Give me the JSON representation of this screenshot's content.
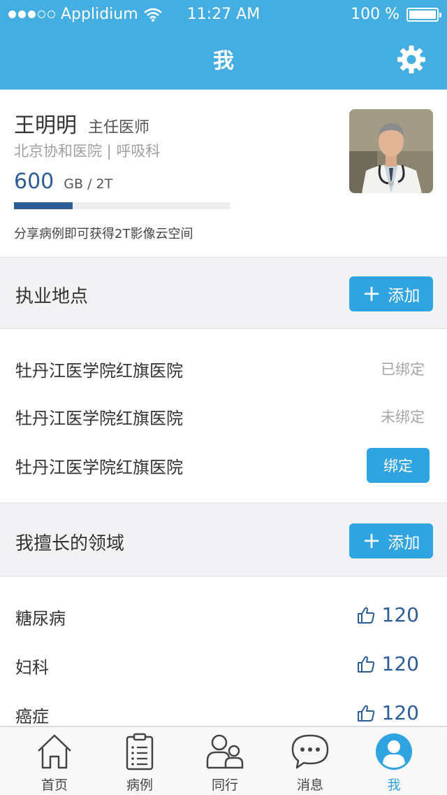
{
  "status_bar": {
    "carrier": "Applidium",
    "time": "11:27 AM",
    "battery": "100 %"
  },
  "nav": {
    "title": "我"
  },
  "profile": {
    "name": "王明明",
    "role": "主任医师",
    "hospital": "北京协和医院 | 呼吸科",
    "storage_value": "600",
    "storage_unit": "GB / 2T",
    "storage_fraction": 0.27,
    "share_text": "分享病例即可获得2T影像云空间"
  },
  "practice": {
    "header": "执业地点",
    "add_label": "添加",
    "items": [
      {
        "name": "牡丹江医学院红旗医院",
        "status": "已绑定"
      },
      {
        "name": "牡丹江医学院红旗医院",
        "status": "未绑定"
      },
      {
        "name": "牡丹江医学院红旗医院",
        "action": "绑定"
      }
    ]
  },
  "specialties": {
    "header": "我擅长的领域",
    "add_label": "添加",
    "items": [
      {
        "name": "糖尿病",
        "likes": "120"
      },
      {
        "name": "妇科",
        "likes": "120"
      },
      {
        "name": "癌症",
        "likes": "120"
      }
    ]
  },
  "tabs": [
    {
      "label": "首页",
      "icon": "home-icon"
    },
    {
      "label": "病例",
      "icon": "clipboard-icon"
    },
    {
      "label": "同行",
      "icon": "peers-icon"
    },
    {
      "label": "消息",
      "icon": "chat-bubble-icon"
    },
    {
      "label": "我",
      "icon": "user-icon",
      "active": true
    }
  ],
  "colors": {
    "header": "#44ade2",
    "accent": "#30a4e0",
    "storage": "#2d5d96"
  }
}
